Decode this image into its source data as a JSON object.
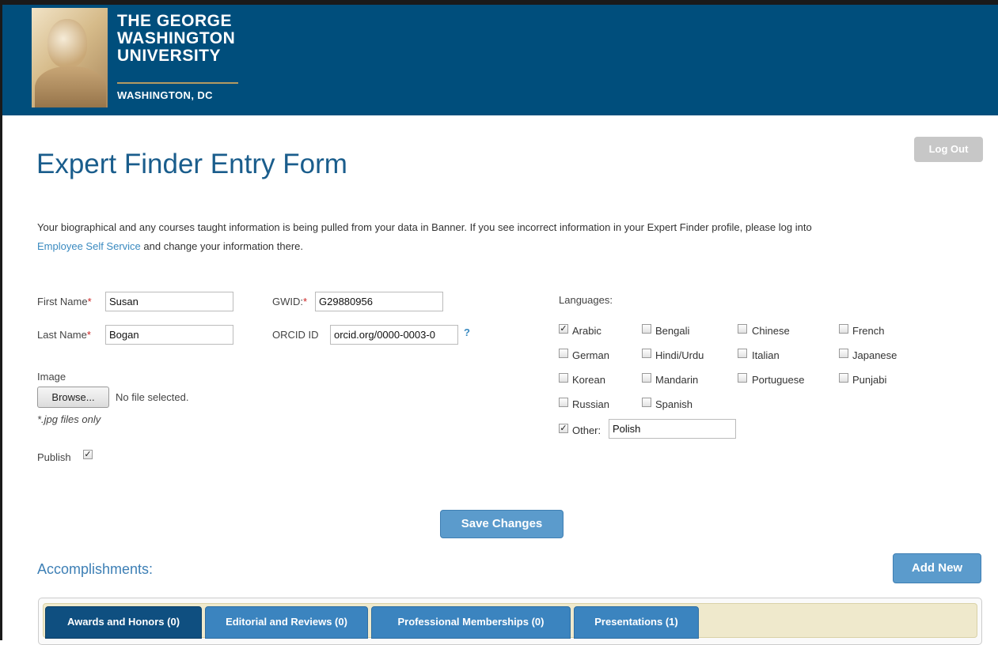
{
  "header": {
    "logo_lines": [
      "THE GEORGE",
      "WASHINGTON",
      "UNIVERSITY"
    ],
    "logo_city": "WASHINGTON, DC",
    "brand_color": "#004e7c"
  },
  "logout_label": "Log Out",
  "page_title": "Expert Finder Entry Form",
  "intro": {
    "text_before": "Your biographical and any courses taught information is being pulled from your data in Banner. If you see incorrect information in your Expert Finder profile, please log into",
    "link_text": "Employee Self Service",
    "text_after": " and change your information there."
  },
  "form": {
    "first_name_label": "First Name",
    "first_name_value": "Susan",
    "last_name_label": "Last Name",
    "last_name_value": "Bogan",
    "required_mark": "*",
    "gwid_label": "GWID:",
    "gwid_value": "G29880956",
    "orcid_label": "ORCID ID",
    "orcid_value": "orcid.org/0000-0003-0",
    "orcid_help": "?",
    "image_label": "Image",
    "browse_label": "Browse...",
    "file_status": "No file selected.",
    "file_note": "*.jpg files only",
    "publish_label": "Publish",
    "publish_checked": true
  },
  "languages": {
    "title": "Languages:",
    "items": [
      {
        "label": "Arabic",
        "checked": true
      },
      {
        "label": "Bengali",
        "checked": false
      },
      {
        "label": "Chinese",
        "checked": false
      },
      {
        "label": "French",
        "checked": false
      },
      {
        "label": "German",
        "checked": false
      },
      {
        "label": "Hindi/Urdu",
        "checked": false
      },
      {
        "label": "Italian",
        "checked": false
      },
      {
        "label": "Japanese",
        "checked": false
      },
      {
        "label": "Korean",
        "checked": false
      },
      {
        "label": "Mandarin",
        "checked": false
      },
      {
        "label": "Portuguese",
        "checked": false
      },
      {
        "label": "Punjabi",
        "checked": false
      },
      {
        "label": "Russian",
        "checked": false
      },
      {
        "label": "Spanish",
        "checked": false
      }
    ],
    "other_label": "Other:",
    "other_checked": true,
    "other_value": "Polish"
  },
  "save_label": "Save Changes",
  "accomplishments": {
    "title": "Accomplishments:",
    "add_new_label": "Add New",
    "tabs": [
      {
        "label": "Awards and Honors (0)",
        "active": true
      },
      {
        "label": "Editorial and Reviews (0)",
        "active": false
      },
      {
        "label": "Professional Memberships (0)",
        "active": false
      },
      {
        "label": "Presentations (1)",
        "active": false
      }
    ]
  }
}
